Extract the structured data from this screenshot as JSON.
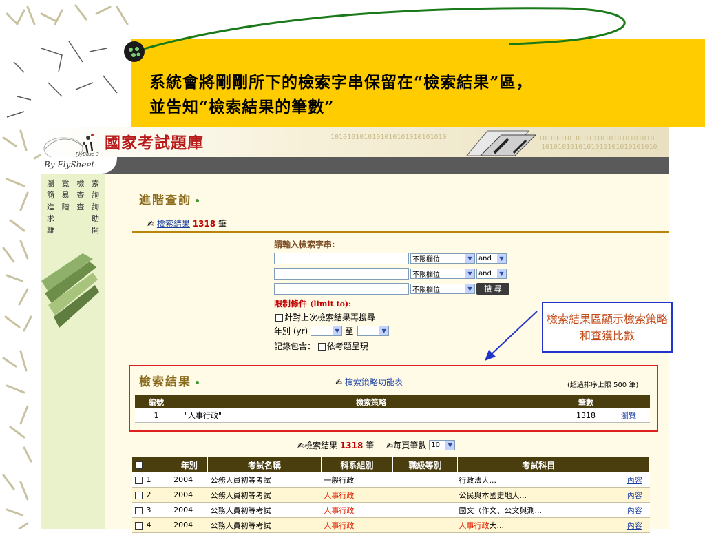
{
  "slide": {
    "title_line1": "系統會將剛剛所下的檢索字串保留在“檢索結果”區，",
    "title_line2": "並告知“檢索結果的筆數”"
  },
  "colors": {
    "band": "#ffcc00",
    "header_bar": "#4a3e0f",
    "accent_red": "#c00000",
    "link": "#1a3fa3"
  },
  "header": {
    "site_title": "國家考試題庫",
    "brand": "By FlySheet",
    "flybase": "FlyBase 3",
    "binary_1": "1010101010101010101010101010",
    "binary_2": "1010101010101010101010101010",
    "binary_3": "1010101010101010101010101010"
  },
  "sidebar": {
    "items": [
      {
        "a": "瀏",
        "b": "覽",
        "c": "檢",
        "d": "索"
      },
      {
        "a": "簡",
        "b": "易",
        "c": "查",
        "d": "詢"
      },
      {
        "a": "進",
        "b": "階",
        "c": "查",
        "d": "詢"
      },
      {
        "a": "求",
        "b": "",
        "c": "",
        "d": "助"
      },
      {
        "a": "離",
        "b": "",
        "c": "",
        "d": "開"
      }
    ]
  },
  "advanced": {
    "title": "進階查詢",
    "result_label": "檢索結果",
    "result_count": "1318",
    "result_unit": "筆"
  },
  "form": {
    "prompt": "請輸入檢索字串:",
    "rows": [
      {
        "field": "不限欄位",
        "op": "and"
      },
      {
        "field": "不限欄位",
        "op": "and"
      },
      {
        "field": "不限欄位"
      }
    ],
    "search_label": "搜 尋",
    "limit_label": "限制條件",
    "limit_en": "(limit to):",
    "refine_label": "針對上次檢索結果再搜尋",
    "year_label": "年別 (yr)",
    "year_to": "至",
    "include_label": "記錄包含：",
    "include_opt": "依考題呈現"
  },
  "callout": {
    "text": "檢索結果區顯示檢索策略和查獲比數"
  },
  "results_section": {
    "title": "檢索結果",
    "strategy_link": "檢索策略功能表",
    "limit_note": "(超過排序上限 500 筆)",
    "headers": [
      "編號",
      "檢索策略",
      "筆數",
      ""
    ],
    "rows": [
      {
        "no": "1",
        "strategy": "\"人事行政\"",
        "count": "1318",
        "action": "瀏覽"
      }
    ]
  },
  "pager": {
    "result_label": "檢索結果",
    "count": "1318",
    "unit": "筆",
    "per_page_label": "每頁筆數",
    "per_page_value": "10"
  },
  "table": {
    "headers": [
      "年別",
      "考試名稱",
      "科系組別",
      "職級等別",
      "考試科目"
    ],
    "rows": [
      {
        "no": "1",
        "year": "2004",
        "exam": "公務人員初等考試",
        "dept": "一般行政",
        "dept_red": false,
        "level": "",
        "subject_red": "",
        "subject": "行政法大...",
        "link": "內容"
      },
      {
        "no": "2",
        "year": "2004",
        "exam": "公務人員初等考試",
        "dept": "人事行政",
        "dept_red": true,
        "level": "",
        "subject_red": "",
        "subject": "公民與本國史地大...",
        "link": "內容"
      },
      {
        "no": "3",
        "year": "2004",
        "exam": "公務人員初等考試",
        "dept": "人事行政",
        "dept_red": true,
        "level": "",
        "subject_red": "",
        "subject": "國文（作文、公文與測...",
        "link": "內容"
      },
      {
        "no": "4",
        "year": "2004",
        "exam": "公務人員初等考試",
        "dept": "人事行政",
        "dept_red": true,
        "level": "",
        "subject_red": "人事行政",
        "subject": "大...",
        "link": "內容"
      }
    ]
  }
}
